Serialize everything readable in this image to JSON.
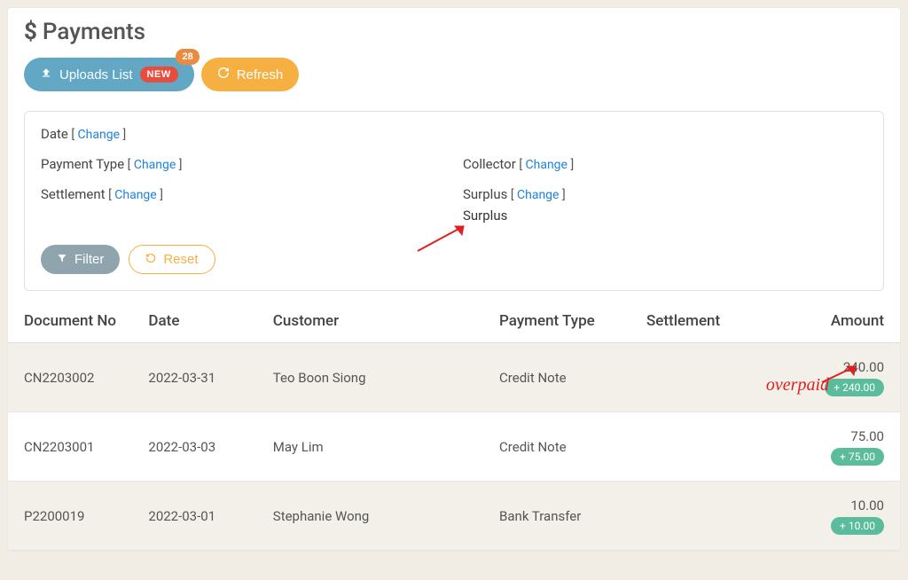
{
  "page": {
    "title": "Payments"
  },
  "buttons": {
    "uploads": "Uploads List",
    "uploads_badge": "NEW",
    "uploads_count": "28",
    "refresh": "Refresh",
    "filter": "Filter",
    "reset": "Reset"
  },
  "filters": {
    "date": {
      "label": "Date",
      "change": "Change"
    },
    "payment_type": {
      "label": "Payment Type",
      "change": "Change"
    },
    "settlement": {
      "label": "Settlement",
      "change": "Change"
    },
    "collector": {
      "label": "Collector",
      "change": "Change"
    },
    "surplus": {
      "label": "Surplus",
      "change": "Change",
      "value": "Surplus"
    }
  },
  "columns": {
    "doc": "Document No",
    "date": "Date",
    "customer": "Customer",
    "payment_type": "Payment Type",
    "settlement": "Settlement",
    "amount": "Amount"
  },
  "rows": [
    {
      "doc": "CN2203002",
      "date": "2022-03-31",
      "customer": "Teo Boon Siong",
      "payment_type": "Credit Note",
      "settlement": "",
      "amount": "240.00",
      "surplus": "240.00"
    },
    {
      "doc": "CN2203001",
      "date": "2022-03-03",
      "customer": "May Lim",
      "payment_type": "Credit Note",
      "settlement": "",
      "amount": "75.00",
      "surplus": "75.00"
    },
    {
      "doc": "P2200019",
      "date": "2022-03-01",
      "customer": "Stephanie Wong",
      "payment_type": "Bank Transfer",
      "settlement": "",
      "amount": "10.00",
      "surplus": "10.00"
    }
  ],
  "annotations": {
    "overpaid": "overpaid"
  }
}
